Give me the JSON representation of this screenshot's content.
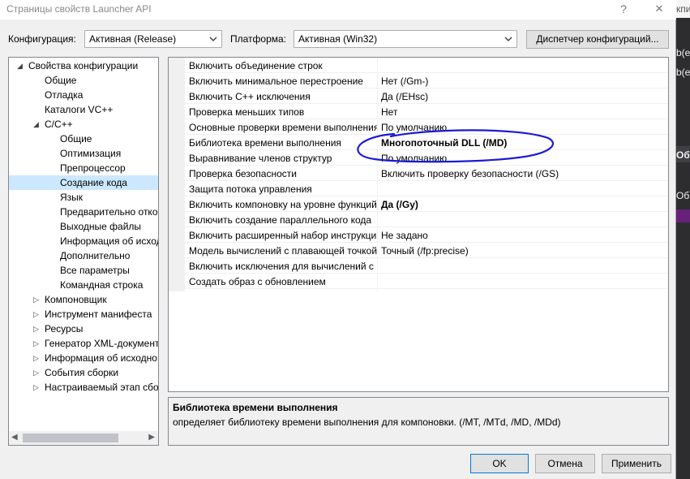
{
  "window": {
    "title": "Страницы свойств Launcher API",
    "help_glyph": "?",
    "close_glyph": "✕"
  },
  "toolbar": {
    "config_label": "Конфигурация:",
    "config_value": "Активная (Release)",
    "platform_label": "Платформа:",
    "platform_value": "Активная (Win32)",
    "config_manager_button": "Диспетчер конфигураций..."
  },
  "tree": {
    "items": [
      {
        "label": "Свойства конфигурации",
        "level": 0,
        "expander": "open"
      },
      {
        "label": "Общие",
        "level": 1,
        "expander": "none"
      },
      {
        "label": "Отладка",
        "level": 1,
        "expander": "none"
      },
      {
        "label": "Каталоги VC++",
        "level": 1,
        "expander": "none"
      },
      {
        "label": "C/C++",
        "level": 1,
        "expander": "open"
      },
      {
        "label": "Общие",
        "level": 2,
        "expander": "none"
      },
      {
        "label": "Оптимизация",
        "level": 2,
        "expander": "none"
      },
      {
        "label": "Препроцессор",
        "level": 2,
        "expander": "none"
      },
      {
        "label": "Создание кода",
        "level": 2,
        "expander": "none",
        "selected": true
      },
      {
        "label": "Язык",
        "level": 2,
        "expander": "none"
      },
      {
        "label": "Предварительно отко",
        "level": 2,
        "expander": "none"
      },
      {
        "label": "Выходные файлы",
        "level": 2,
        "expander": "none"
      },
      {
        "label": "Информация об исход",
        "level": 2,
        "expander": "none"
      },
      {
        "label": "Дополнительно",
        "level": 2,
        "expander": "none"
      },
      {
        "label": "Все параметры",
        "level": 2,
        "expander": "none"
      },
      {
        "label": "Командная строка",
        "level": 2,
        "expander": "none"
      },
      {
        "label": "Компоновщик",
        "level": 1,
        "expander": "closed"
      },
      {
        "label": "Инструмент манифеста",
        "level": 1,
        "expander": "closed"
      },
      {
        "label": "Ресурсы",
        "level": 1,
        "expander": "closed"
      },
      {
        "label": "Генератор XML-документ",
        "level": 1,
        "expander": "closed"
      },
      {
        "label": "Информация об исходно",
        "level": 1,
        "expander": "closed"
      },
      {
        "label": "События сборки",
        "level": 1,
        "expander": "closed"
      },
      {
        "label": "Настраиваемый этап сбо",
        "level": 1,
        "expander": "closed"
      }
    ],
    "scroll_left_glyph": "◀",
    "scroll_right_glyph": "▶"
  },
  "properties": [
    {
      "name": "Включить объединение строк",
      "value": "",
      "bold": false
    },
    {
      "name": "Включить минимальное перестроение",
      "value": "Нет (/Gm-)",
      "bold": false
    },
    {
      "name": "Включить C++ исключения",
      "value": "Да (/EHsc)",
      "bold": false
    },
    {
      "name": "Проверка меньших типов",
      "value": "Нет",
      "bold": false
    },
    {
      "name": "Основные проверки времени выполнения",
      "value": "По умолчанию",
      "bold": false
    },
    {
      "name": "Библиотека времени выполнения",
      "value": "Многопоточный DLL (/MD)",
      "bold": true
    },
    {
      "name": "Выравнивание членов структур",
      "value": "По умолчанию",
      "bold": false
    },
    {
      "name": "Проверка безопасности",
      "value": "Включить проверку безопасности (/GS)",
      "bold": false
    },
    {
      "name": "Защита потока управления",
      "value": "",
      "bold": false
    },
    {
      "name": "Включить компоновку на уровне функций",
      "value": "Да (/Gy)",
      "bold": true
    },
    {
      "name": "Включить создание параллельного кода",
      "value": "",
      "bold": false
    },
    {
      "name": "Включить расширенный набор инструкций",
      "value": "Не задано",
      "bold": false
    },
    {
      "name": "Модель вычислений с плавающей точкой",
      "value": "Точный (/fp:precise)",
      "bold": false
    },
    {
      "name": "Включить исключения для вычислений с плавающей точкой",
      "value": "",
      "bold": false
    },
    {
      "name": "Создать образ с обновлением",
      "value": "",
      "bold": false
    }
  ],
  "description": {
    "title": "Библиотека времени выполнения",
    "text": "определяет библиотеку времени выполнения для компоновки.     (/MT, /MTd, /MD, /MDd)"
  },
  "buttons": {
    "ok": "OK",
    "cancel": "Отмена",
    "apply": "Применить"
  },
  "background_window": {
    "fragments": [
      "кпи",
      "b(e",
      "b(e",
      "Об",
      "Об"
    ]
  },
  "colors": {
    "selection": "#cce8ff",
    "annotation": "#1a1ad6"
  }
}
